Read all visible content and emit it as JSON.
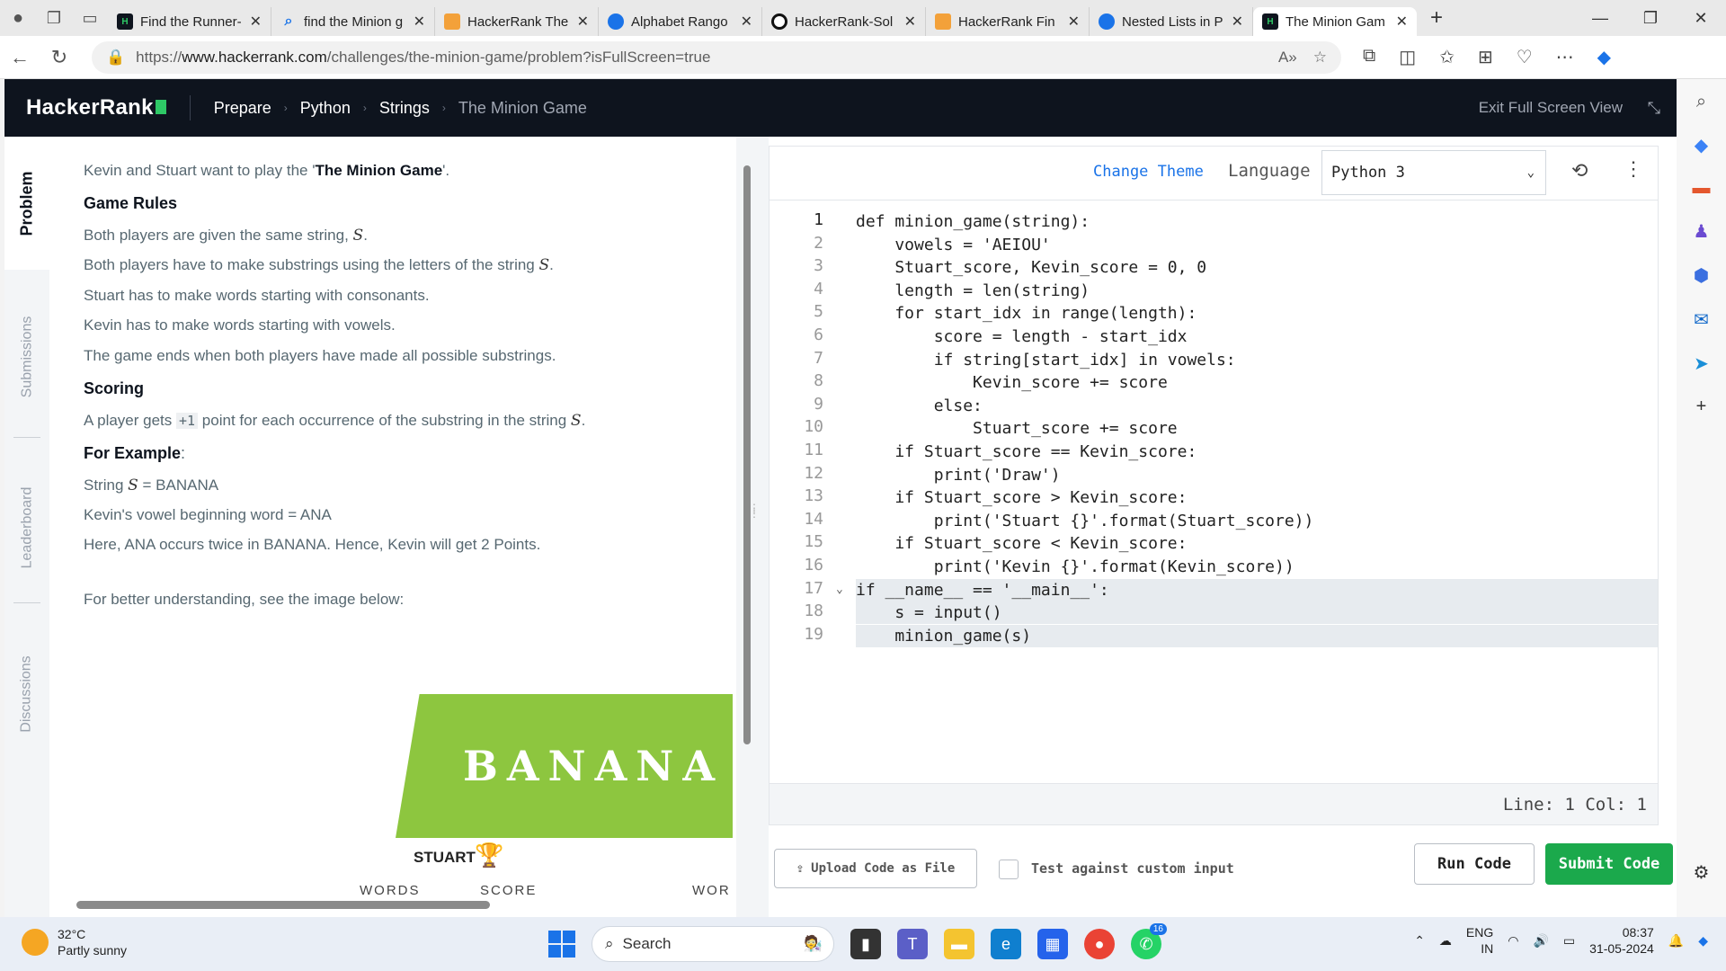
{
  "browser": {
    "tabs": [
      {
        "title": "Find the Runner-",
        "favicon": "hr",
        "active": false
      },
      {
        "title": "find the Minion g",
        "favicon": "google",
        "active": false
      },
      {
        "title": "HackerRank The",
        "favicon": "so",
        "active": false
      },
      {
        "title": "Alphabet Rango",
        "favicon": "cr",
        "active": false
      },
      {
        "title": "HackerRank-Sol",
        "favicon": "github",
        "active": false
      },
      {
        "title": "HackerRank Fin",
        "favicon": "so",
        "active": false
      },
      {
        "title": "Nested Lists in P",
        "favicon": "cr",
        "active": false
      },
      {
        "title": "The Minion Gam",
        "favicon": "hr",
        "active": true
      }
    ],
    "new_tab": "+",
    "url_prefix": "https://",
    "url_domain": "www.hackerrank.com",
    "url_path": "/challenges/the-minion-game/problem?isFullScreen=true"
  },
  "header": {
    "logo": "HackerRank",
    "breadcrumb": [
      "Prepare",
      "Python",
      "Strings",
      "The Minion Game"
    ],
    "exit_fullscreen": "Exit Full Screen View"
  },
  "side_tabs": [
    "Problem",
    "Submissions",
    "Leaderboard",
    "Discussions"
  ],
  "problem": {
    "intro_pre": "Kevin and Stuart want to play the '",
    "intro_bold": "The Minion Game",
    "intro_post": "'.",
    "rules_heading": "Game Rules",
    "rule1_pre": "Both players are given the same string, ",
    "rule2_pre": "Both players have to make substrings using the letters of the string ",
    "rule3": "Stuart has to make words starting with consonants.",
    "rule4": "Kevin has to make words starting with vowels.",
    "rule5": "The game ends when both players have made all possible substrings.",
    "math_s": "S",
    "dot": ".",
    "scoring_heading": "Scoring",
    "scoring_pre": "A player gets ",
    "scoring_code": "+1",
    "scoring_post": " point for each occurrence of the substring in the string ",
    "example_heading": "For Example",
    "example_colon": ":",
    "ex1_pre": "String ",
    "ex1_post": " = BANANA",
    "ex2": "Kevin's vowel beginning word = ANA",
    "ex3": "Here, ANA occurs twice in BANANA. Hence, Kevin will get 2 Points.",
    "image_note": "For better understanding, see the image below:",
    "image_word": "BANANA",
    "image_player": "STUART",
    "image_col_words": "WORDS",
    "image_col_score": "SCORE",
    "image_col_words2": "WOR"
  },
  "editor": {
    "change_theme": "Change Theme",
    "language_label": "Language",
    "language_value": "Python 3",
    "status": "Line: 1 Col: 1",
    "code_lines": [
      "def minion_game(string):",
      "    vowels = 'AEIOU'",
      "    Stuart_score, Kevin_score = 0, 0",
      "    length = len(string)",
      "    for start_idx in range(length):",
      "        score = length - start_idx",
      "        if string[start_idx] in vowels:",
      "            Kevin_score += score",
      "        else:",
      "            Stuart_score += score",
      "    if Stuart_score == Kevin_score:",
      "        print('Draw')",
      "    if Stuart_score > Kevin_score:",
      "        print('Stuart {}'.format(Stuart_score))",
      "    if Stuart_score < Kevin_score:",
      "        print('Kevin {}'.format(Kevin_score))",
      "if __name__ == '__main__':",
      "    s = input()",
      "    minion_game(s)"
    ]
  },
  "actions": {
    "upload": "Upload Code as File",
    "custom_input": "Test against custom input",
    "run": "Run Code",
    "submit": "Submit Code"
  },
  "taskbar": {
    "temp": "32°C",
    "weather": "Partly sunny",
    "search": "Search",
    "whatsapp_badge": "16",
    "lang1": "ENG",
    "lang2": "IN",
    "time": "08:37",
    "date": "31-05-2024"
  },
  "colors": {
    "hr_green": "#2ec866",
    "submit_green": "#1ba94c",
    "header_bg": "#0e141e"
  }
}
